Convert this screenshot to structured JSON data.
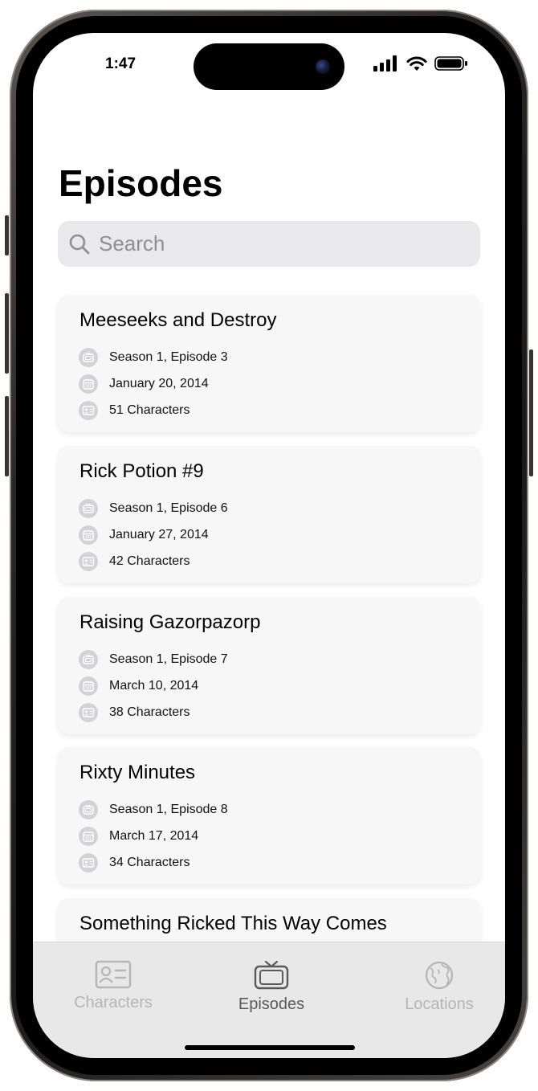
{
  "status_bar": {
    "time": "1:47"
  },
  "header": {
    "title": "Episodes"
  },
  "search": {
    "placeholder": "Search",
    "value": ""
  },
  "episodes": [
    {
      "title": "Meeseeks and Destroy",
      "episode": "Season 1, Episode 3",
      "air_date": "January 20, 2014",
      "characters": "51 Characters"
    },
    {
      "title": "Rick Potion #9",
      "episode": "Season 1, Episode 6",
      "air_date": "January 27, 2014",
      "characters": "42 Characters"
    },
    {
      "title": "Raising Gazorpazorp",
      "episode": "Season 1, Episode 7",
      "air_date": "March 10, 2014",
      "characters": "38 Characters"
    },
    {
      "title": "Rixty Minutes",
      "episode": "Season 1, Episode 8",
      "air_date": "March 17, 2014",
      "characters": "34 Characters"
    },
    {
      "title": "Something Ricked This Way Comes"
    }
  ],
  "tab_bar": {
    "tabs": [
      {
        "label": "Characters",
        "icon": "person-card-icon",
        "active": false
      },
      {
        "label": "Episodes",
        "icon": "tv-icon",
        "active": true
      },
      {
        "label": "Locations",
        "icon": "globe-icon",
        "active": false
      }
    ]
  },
  "colors": {
    "background": "#ffffff",
    "card": "#f7f7f7",
    "search_field": "#e9e9ec",
    "tab_bar": "#e8e8e8",
    "tab_inactive": "#b5b5b5",
    "tab_active": "#5a5a5a"
  }
}
